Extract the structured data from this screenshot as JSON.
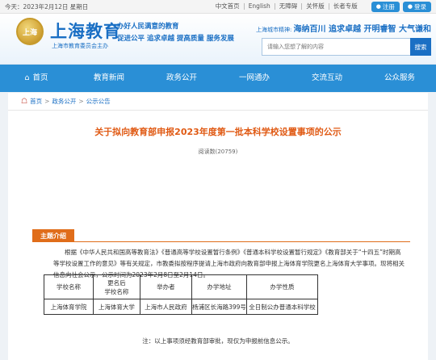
{
  "topbar": {
    "date": "今天：2023年2月12日 星期日",
    "links": [
      "中文首页",
      "English",
      "无障碍",
      "关怀版",
      "长者专版"
    ],
    "register": "注册",
    "login": "登录"
  },
  "header": {
    "emblem_text": "上海",
    "title": "上海教育",
    "subtitle": "上海市教育委员会主办",
    "slogan1": "办好人民满意的教育",
    "slogan2": "促进公平 追求卓越 提高质量 服务发展",
    "city_spirit_label": "上海城市精神:",
    "city_spirit": "海纳百川 追求卓越 开明睿智 大气谦和",
    "search_placeholder": "请输入您想了解的内容",
    "search_button": "搜索"
  },
  "nav": [
    {
      "label": "首页",
      "icon": "home-icon"
    },
    {
      "label": "教育新闻"
    },
    {
      "label": "政务公开"
    },
    {
      "label": "一网通办"
    },
    {
      "label": "交流互动"
    },
    {
      "label": "公众服务"
    }
  ],
  "breadcrumb": [
    "首页",
    "政务公开",
    "公示公告"
  ],
  "article": {
    "title": "关于拟向教育部申报2023年度第一批本科学校设置事项的公示",
    "views": "阅读数(20759)",
    "section": "主题介绍",
    "paragraph": "根据《中华人民共和国高等教育法》《普通高等学校设置暂行条例》《普通本科学校设置暂行规定》《教育部关于“十四五”时期高等学校设置工作的意见》等有关规定，市教委拟按程序提请上海市政府向教育部申报上海体育学院更名上海体育大学事项。现将相关信息向社会公示，公示时间为2023年2月8日至2月14日。",
    "table": {
      "headers": [
        "学校名称",
        "更名后\n学校名称",
        "举办者",
        "办学地址",
        "办学性质"
      ],
      "rows": [
        [
          "上海体育学院",
          "上海体育大学",
          "上海市人民政府",
          "杨浦区长海路399号",
          "全日制公办普通本科学校"
        ]
      ]
    },
    "note": "注：以上事项须经教育部审批，现仅为申报前信息公示。"
  },
  "colors": {
    "primary": "#2a8fd6",
    "title_orange": "#e05a14",
    "section_orange": "#e06d1a"
  }
}
